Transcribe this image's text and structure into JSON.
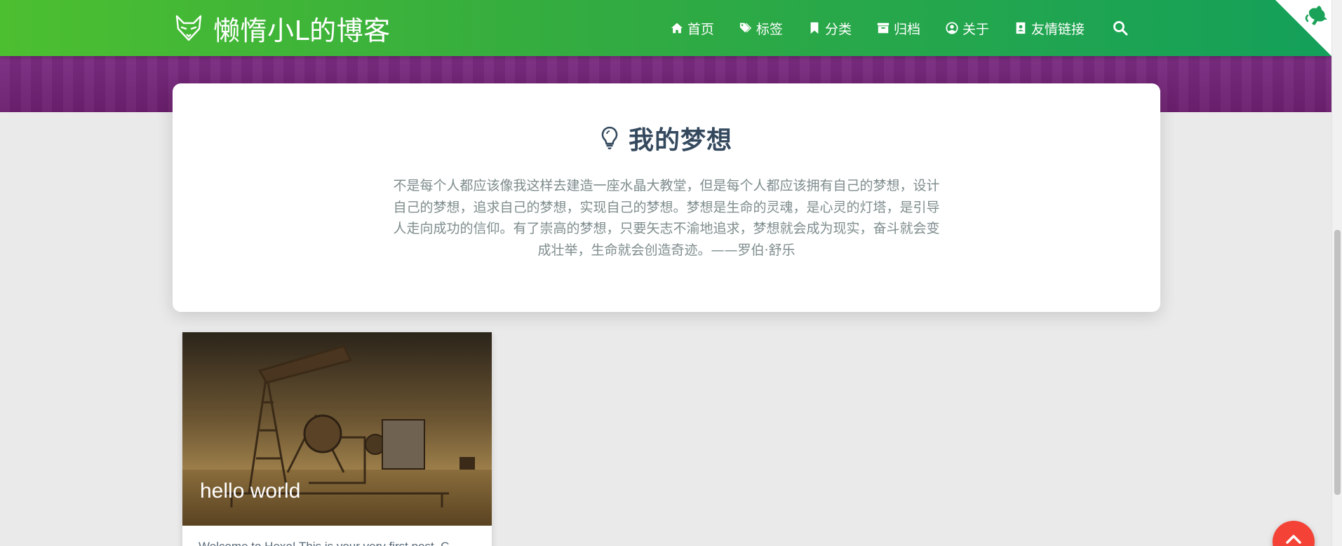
{
  "site": {
    "title": "懒惰小L的博客",
    "logo_icon": "fox-logo-icon"
  },
  "nav": {
    "items": [
      {
        "label": "首页",
        "icon": "home-icon"
      },
      {
        "label": "标签",
        "icon": "tags-icon"
      },
      {
        "label": "分类",
        "icon": "bookmark-icon"
      },
      {
        "label": "归档",
        "icon": "archive-icon"
      },
      {
        "label": "关于",
        "icon": "user-circle-icon"
      },
      {
        "label": "友情链接",
        "icon": "address-book-icon"
      }
    ],
    "search_icon": "search-icon"
  },
  "colors": {
    "header_start": "#4cbf30",
    "header_end": "#14a05a",
    "hero_band": "#7a2b7f",
    "back_to_top": "#f44336"
  },
  "dream": {
    "icon": "lightbulb-icon",
    "title": "我的梦想",
    "lines": [
      "不是每个人都应该像我这样去建造一座水晶大教堂，但是每个人都应该拥有自己的梦想，设计",
      "自己的梦想，追求自己的梦想，实现自己的梦想。梦想是生命的灵魂，是心灵的灯塔，是引导",
      "人走向成功的信仰。有了崇高的梦想，只要矢志不渝地追求，梦想就会成为现实，奋斗就会变",
      "成壮举，生命就会创造奇迹。——罗伯·舒乐"
    ]
  },
  "posts": [
    {
      "title": "hello world",
      "excerpt": "Welcome to Hexo! This is your very first post. C"
    }
  ],
  "back_to_top_icon": "chevron-up-icon"
}
